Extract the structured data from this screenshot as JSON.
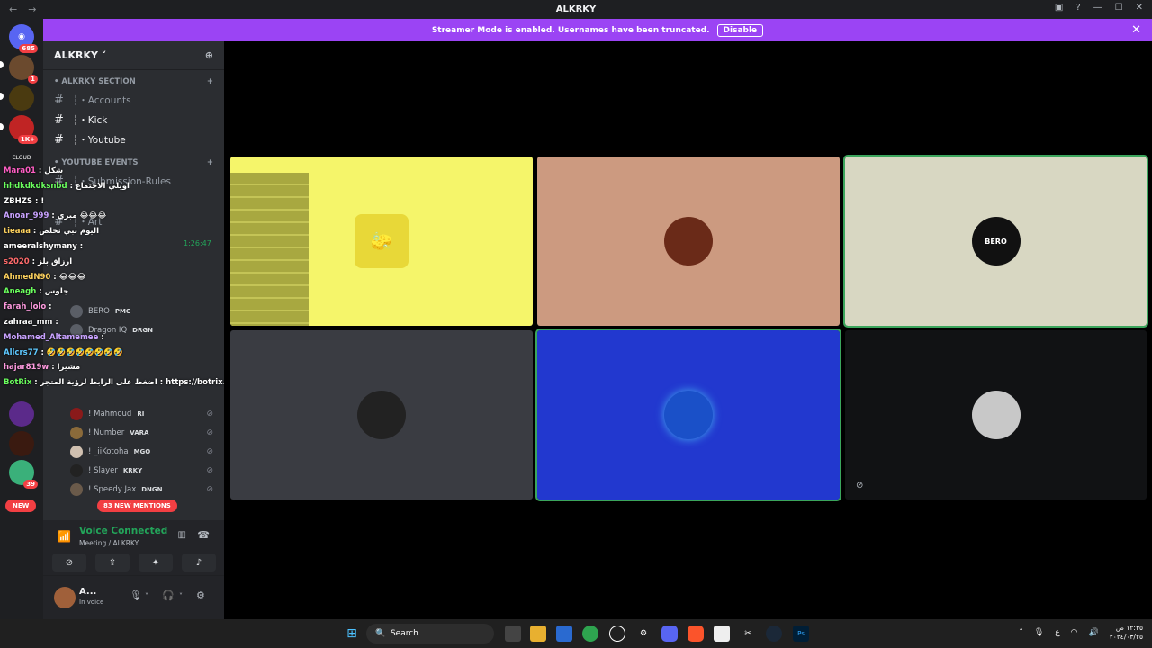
{
  "window": {
    "title": "ALKRKY"
  },
  "banner": {
    "text": "Streamer Mode is enabled. Usernames have been truncated.",
    "disable_label": "Disable"
  },
  "servers": {
    "home_badge": "685",
    "badges": [
      "1",
      "1K+",
      "39"
    ],
    "new_label": "NEW"
  },
  "sidebar": {
    "guild_name": "ALKRKY",
    "category1": "• ALKRKY SECTION",
    "channels1": [
      "┆・Accounts",
      "┆・Kick",
      "┆・Youtube"
    ],
    "category2": "• YOUTUBE EVENTS",
    "channels2": [
      "┆・Submission-Rules",
      "┆・Art"
    ],
    "stage_timer": "1:26:47",
    "members": [
      {
        "name": "BERO",
        "tag": "PMC"
      },
      {
        "name": "Dragon IQ",
        "tag": "DRGN"
      },
      {
        "name": "! Mahmoud",
        "tag": "RI"
      },
      {
        "name": "! Number",
        "tag": "VARA"
      },
      {
        "name": "! _iiKotoha",
        "tag": "MGO"
      },
      {
        "name": "! Slayer",
        "tag": "KRKY"
      },
      {
        "name": "! Speedy Jax",
        "tag": "DNGN"
      }
    ],
    "mentions_label": "83 NEW MENTIONS"
  },
  "voice": {
    "status": "Voice Connected",
    "channel": "Meeting / ALKRKY"
  },
  "user": {
    "name": "A...",
    "status": "In voice"
  },
  "chat_overlay": [
    {
      "user": "Mara01",
      "msg": "شكل"
    },
    {
      "user": "hhdkdkdksnbd",
      "msg": "اويلي الاجتماع"
    },
    {
      "user": "ZBHZS",
      "msg": "!"
    },
    {
      "user": "Anoar_999",
      "msg": "مبري 😂😂😂"
    },
    {
      "user": "tieaaa",
      "msg": "اليوم نبي نخلص"
    },
    {
      "user": "ameeralshymany",
      "msg": ""
    },
    {
      "user": "s2020",
      "msg": "ارزاق بلز"
    },
    {
      "user": "AhmedN90",
      "msg": "😂😂😂"
    },
    {
      "user": "Aneagh",
      "msg": "جلوس"
    },
    {
      "user": "farah_lolo",
      "msg": ""
    },
    {
      "user": "zahraa_mm",
      "msg": ""
    },
    {
      "user": "Mohamed_Altamemee",
      "msg": ""
    },
    {
      "user": "Allcrs77",
      "msg": "🤣🤣🤣🤣🤣🤣🤣🤣"
    },
    {
      "user": "hajar819w",
      "msg": "مشيرا"
    },
    {
      "user": "BotRix",
      "msg": "اضغط على الرابط لرؤية المتجر : https://botrix.live/k/alkrky99/shop"
    }
  ],
  "tiles": [
    {
      "name": "spongebob-tile",
      "bg": "#f5f56a",
      "label": ""
    },
    {
      "name": "user-tile-2",
      "bg": "#cc9a80",
      "label": ""
    },
    {
      "name": "bero-tile",
      "bg": "#d8d7c2",
      "label": "BERO"
    },
    {
      "name": "user-tile-4",
      "bg": "#3a3c42",
      "label": ""
    },
    {
      "name": "anime-tile",
      "bg": "#2238cf",
      "label": ""
    },
    {
      "name": "user-tile-6",
      "bg": "#111214",
      "label": ""
    }
  ],
  "taskbar": {
    "search": "Search",
    "time": "١٢:٣٥ ص",
    "date": "٢٠٢٤/٠٣/٢٥",
    "lang": "ع"
  }
}
